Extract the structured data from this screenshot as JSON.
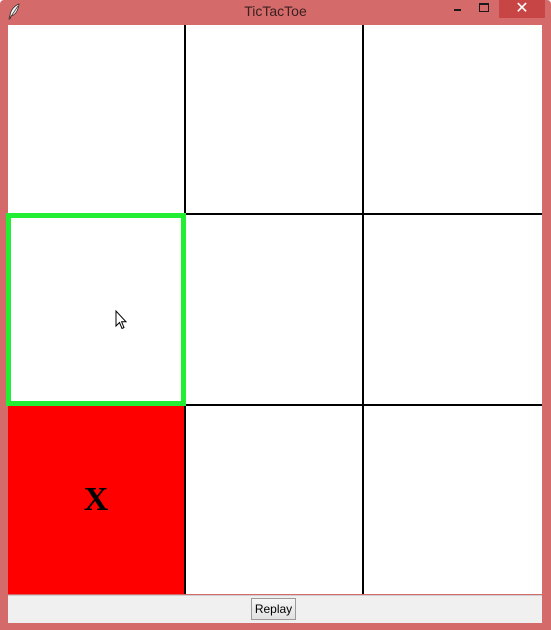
{
  "window": {
    "title": "TicTacToe",
    "close_glyph": "✕"
  },
  "board": {
    "cells": [
      {
        "row": 0,
        "col": 0,
        "mark": "",
        "state": "empty"
      },
      {
        "row": 0,
        "col": 1,
        "mark": "",
        "state": "empty"
      },
      {
        "row": 0,
        "col": 2,
        "mark": "",
        "state": "empty"
      },
      {
        "row": 1,
        "col": 0,
        "mark": "",
        "state": "hover"
      },
      {
        "row": 1,
        "col": 1,
        "mark": "",
        "state": "empty"
      },
      {
        "row": 1,
        "col": 2,
        "mark": "",
        "state": "empty"
      },
      {
        "row": 2,
        "col": 0,
        "mark": "X",
        "state": "filled"
      },
      {
        "row": 2,
        "col": 1,
        "mark": "",
        "state": "empty"
      },
      {
        "row": 2,
        "col": 2,
        "mark": "",
        "state": "empty"
      }
    ]
  },
  "controls": {
    "replay_label": "Replay"
  },
  "colors": {
    "titlebar": "#d46a6a",
    "filled_cell": "#ff0000",
    "hover_border": "#22ee33",
    "grid_line": "#000000"
  }
}
